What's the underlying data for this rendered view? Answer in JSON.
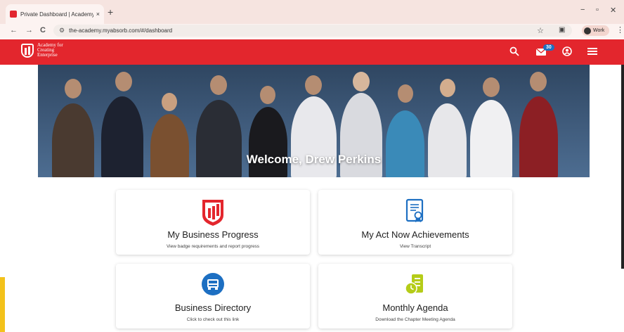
{
  "browser": {
    "tab_title": "Private Dashboard | Academy fo",
    "tab_close": "×",
    "new_tab": "+",
    "url": "the-academy.myabsorb.com/#/dashboard",
    "profile_label": "Work",
    "win_min": "−",
    "win_max": "▫",
    "win_close": "✕",
    "back": "←",
    "forward": "→",
    "reload": "C",
    "star": "☆",
    "menu": "⋮"
  },
  "header": {
    "logo_line1": "Academy for",
    "logo_line2": "Creating",
    "logo_line3": "Enterprise",
    "messages_count": "30",
    "brand_color": "#e3262d"
  },
  "hero": {
    "welcome": "Welcome, Drew Perkins"
  },
  "cards": [
    {
      "title": "My Business Progress",
      "subtitle": "View badge requirements and report progress",
      "icon": "business-progress-icon"
    },
    {
      "title": "My Act Now Achievements",
      "subtitle": "View Transcript",
      "icon": "certificate-icon"
    },
    {
      "title": "Business Directory",
      "subtitle": "Click to check out this link",
      "icon": "directory-icon"
    },
    {
      "title": "Monthly Agenda",
      "subtitle": "Download the Chapter Meeting Agenda",
      "icon": "agenda-icon"
    }
  ]
}
